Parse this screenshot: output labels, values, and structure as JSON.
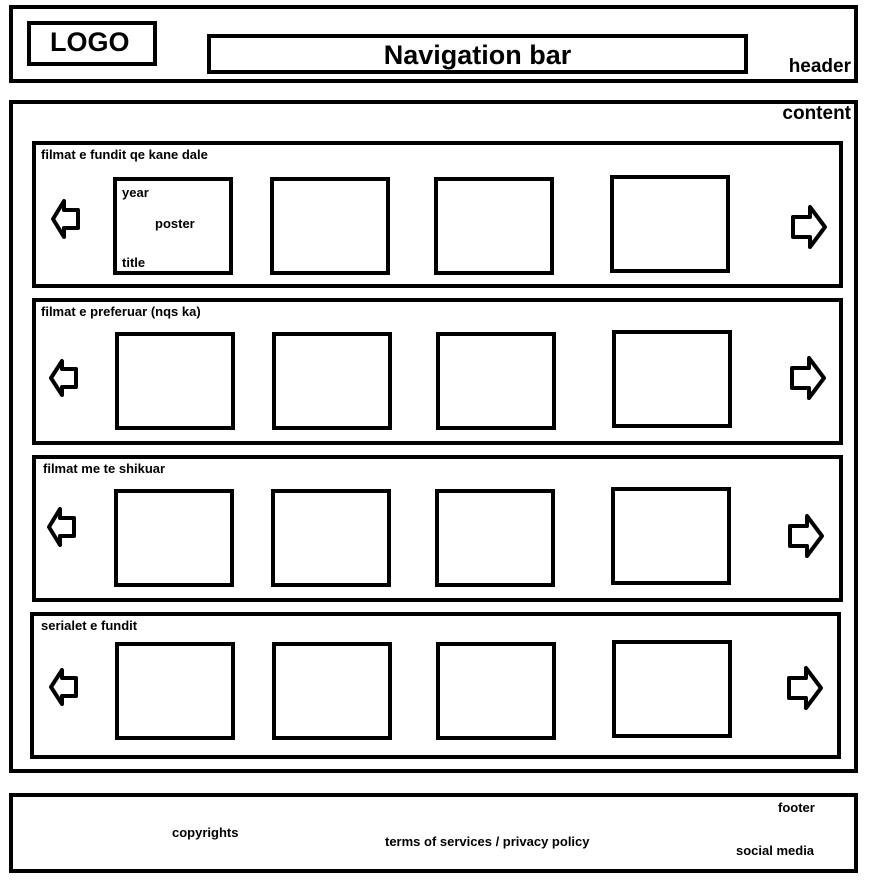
{
  "header": {
    "logo": "LOGO",
    "navigation": "Navigation bar",
    "label": "header"
  },
  "content": {
    "label": "content",
    "rows": [
      {
        "title": "filmat e fundit qe kane dale",
        "first_poster": {
          "year": "year",
          "poster": "poster",
          "title": "title"
        }
      },
      {
        "title": "filmat e preferuar (nqs ka)"
      },
      {
        "title": "filmat me te shikuar"
      },
      {
        "title": "serialet e fundit"
      }
    ]
  },
  "footer": {
    "label": "footer",
    "copyrights": "copyrights",
    "terms": "terms of services / privacy  policy",
    "social": "social media"
  }
}
